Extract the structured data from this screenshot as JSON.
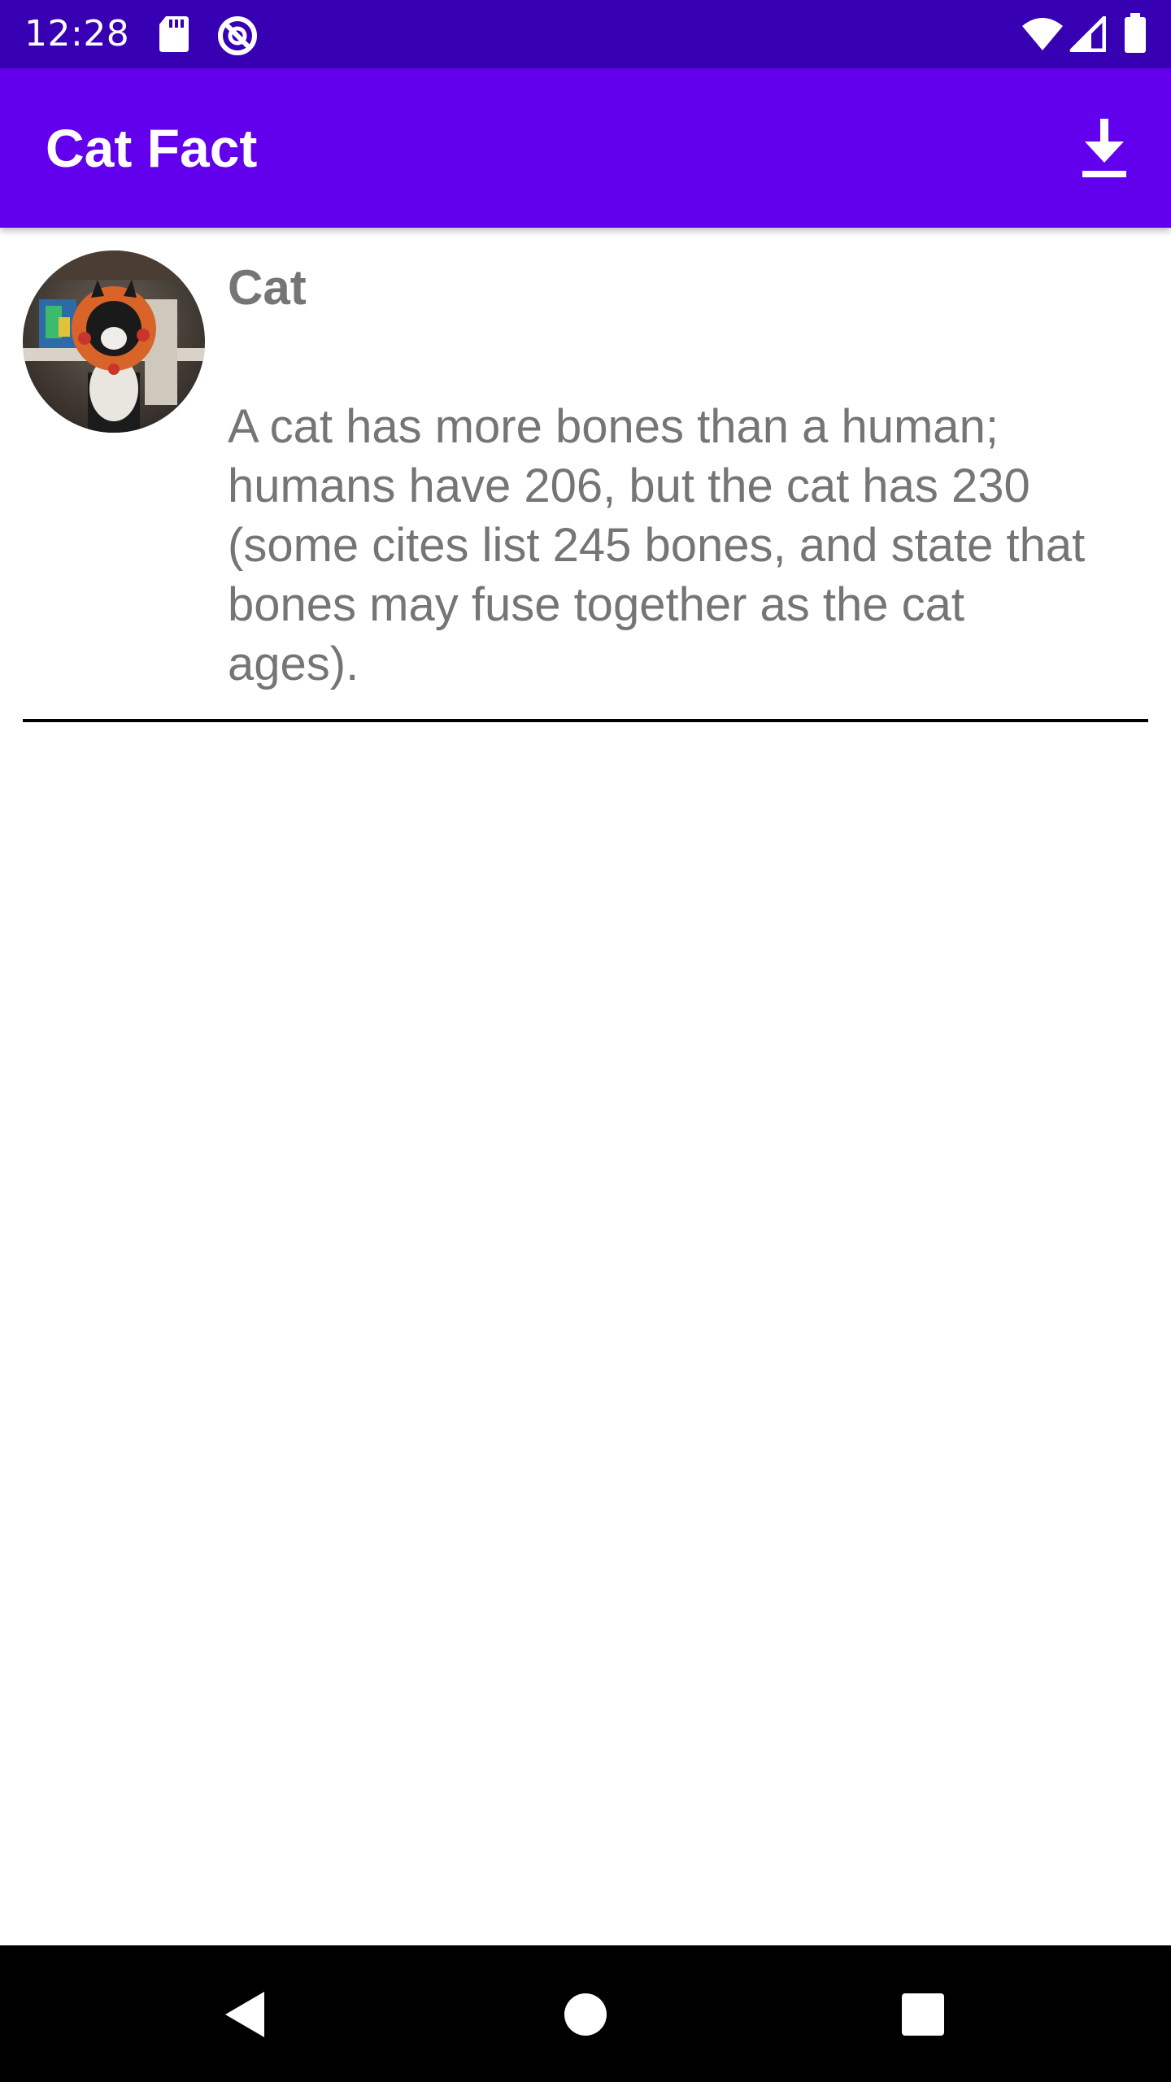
{
  "status_bar": {
    "time": "12:28",
    "icons": [
      "sd-card-icon",
      "sync-disabled-icon",
      "wifi-icon",
      "cell-signal-icon",
      "battery-icon"
    ]
  },
  "app_bar": {
    "title": "Cat Fact",
    "action_icon": "download-icon"
  },
  "colors": {
    "status_bar": "#3700b3",
    "app_bar": "#6200ee",
    "text_secondary": "#757575"
  },
  "list": {
    "items": [
      {
        "title": "Cat",
        "body": "A cat has more bones than a human; humans have 206, but the cat has 230 (some cites list 245 bones, and state that bones may fuse together as the cat ages)."
      }
    ]
  },
  "nav_bar": {
    "buttons": [
      "back-icon",
      "home-icon",
      "recents-icon"
    ]
  }
}
